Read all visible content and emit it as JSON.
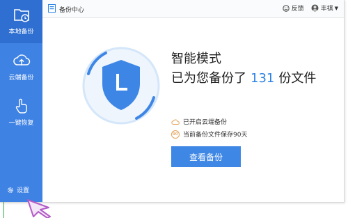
{
  "sidebar": {
    "items": [
      {
        "label": "本地备份",
        "icon": "folder-clock-icon",
        "active": true
      },
      {
        "label": "云端备份",
        "icon": "cloud-upload-icon",
        "active": false
      },
      {
        "label": "一键恢复",
        "icon": "hand-pointer-icon",
        "active": false
      }
    ],
    "settings_label": "设置"
  },
  "titlebar": {
    "title": "备份中心",
    "feedback_label": "反馈",
    "user_name": "丰祺"
  },
  "main": {
    "mode_title": "智能模式",
    "status_prefix": "已为您备份了",
    "file_count": "131",
    "status_suffix": "份文件",
    "cloud_status": "已开启云端备份",
    "retention_badge": "90",
    "retention_text": "当前备份文件保存90天",
    "view_button_label": "查看备份"
  },
  "colors": {
    "sidebar": "#3e82e4",
    "sidebar_active": "#2f6fd1",
    "accent": "#2b82e3",
    "button": "#3f87e5",
    "shield": "#3e86e6",
    "ring": "#d4e6f9"
  }
}
